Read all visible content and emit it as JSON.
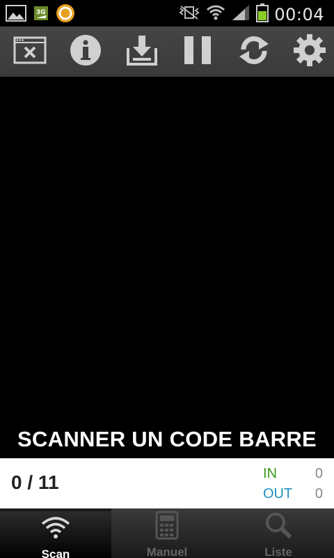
{
  "status_bar": {
    "time": "00:04",
    "network_badge": "3G",
    "icons": [
      "gallery-icon",
      "3g-notification-icon",
      "app-notification-icon",
      "mute-vibrate-icon",
      "wifi-icon",
      "signal-icon",
      "battery-icon"
    ]
  },
  "toolbar": {
    "buttons": [
      "close-window-icon",
      "info-icon",
      "download-icon",
      "pause-icon",
      "refresh-icon",
      "settings-icon"
    ]
  },
  "scan": {
    "prompt": "SCANNER UN CODE BARRE"
  },
  "counter": {
    "main": "0 / 11",
    "in_label": "IN",
    "in_value": "0",
    "out_label": "OUT",
    "out_value": "0"
  },
  "tabs": [
    {
      "label": "Scan",
      "active": true
    },
    {
      "label": "Manuel",
      "active": false
    },
    {
      "label": "Liste",
      "active": false
    }
  ],
  "colors": {
    "in": "#3a9a1a",
    "out": "#1e8fc0",
    "battery": "#8ac926"
  }
}
